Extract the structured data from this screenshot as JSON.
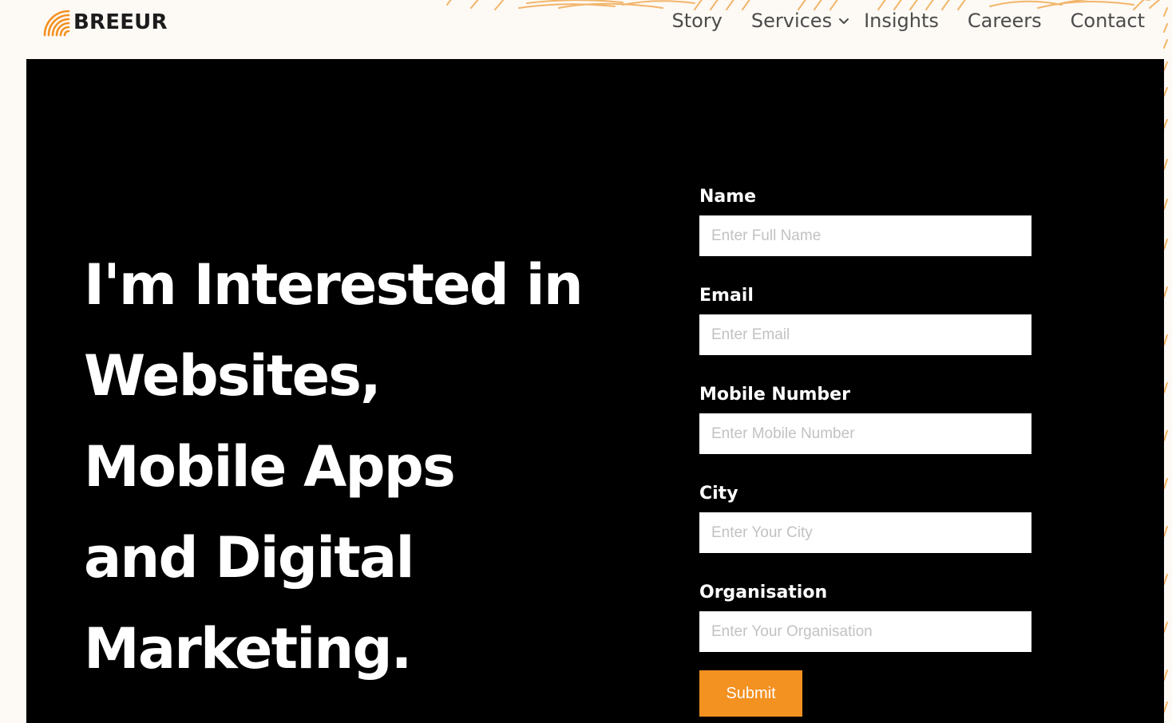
{
  "brand": {
    "name": "BREEUR",
    "accent_color": "#f39121",
    "logo_icon": "sunrise-stripes-icon"
  },
  "nav": {
    "items": [
      {
        "label": "Story"
      },
      {
        "label": "Services",
        "icon": "chevron-down-icon"
      },
      {
        "label": "Insights"
      },
      {
        "label": "Careers"
      },
      {
        "label": "Contact"
      }
    ]
  },
  "hero": {
    "headline_lines": [
      "I'm Interested in",
      "Websites,",
      "Mobile Apps",
      "and Digital",
      "Marketing."
    ],
    "background_color": "#000000"
  },
  "form": {
    "fields": [
      {
        "label": "Name",
        "placeholder": "Enter Full Name",
        "value": ""
      },
      {
        "label": "Email",
        "placeholder": "Enter Email",
        "value": ""
      },
      {
        "label": "Mobile Number",
        "placeholder": "Enter Mobile Number",
        "value": ""
      },
      {
        "label": "City",
        "placeholder": "Enter Your City",
        "value": ""
      },
      {
        "label": "Organisation",
        "placeholder": "Enter Your Organisation",
        "value": ""
      }
    ],
    "submit_label": "Submit"
  }
}
